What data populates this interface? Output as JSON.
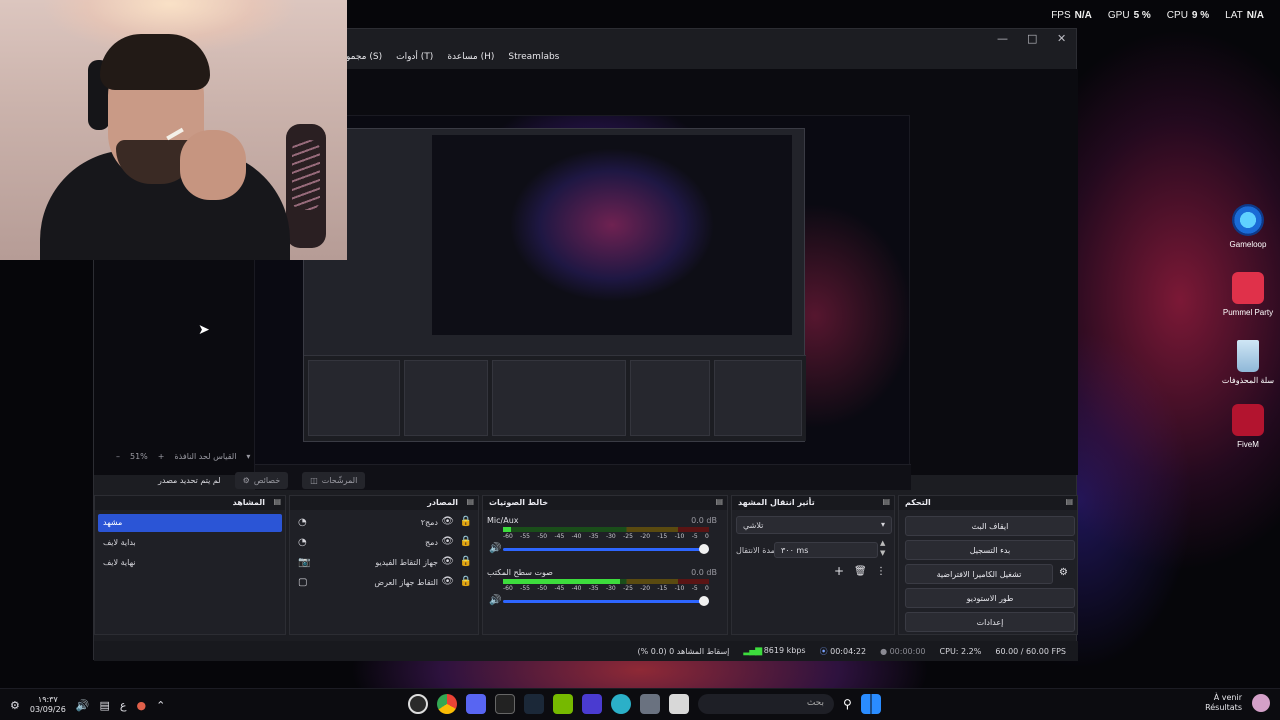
{
  "perf": {
    "fps_label": "FPS",
    "fps_value": "N/A",
    "gpu_label": "GPU",
    "gpu_value": "5 %",
    "cpu_label": "CPU",
    "cpu_value": "9 %",
    "lat_label": "LAT",
    "lat_value": "N/A"
  },
  "desktop_icons": [
    "Gameloop",
    "Pummel Party",
    "سلة المحذوفات",
    "FiveM"
  ],
  "menu": [
    "مجمو (S)",
    "أدوات (T)",
    "مساعدة (H)",
    "Streamlabs"
  ],
  "preview": {
    "zoom": "51%",
    "scale_hint": "القياس لحد النافذة"
  },
  "source_bar": {
    "no_source": "لم يتم تحديد مصدر",
    "properties": "خصائص",
    "filters": "المرشّحات"
  },
  "scenes": {
    "title": "المشاهد",
    "items": [
      "مشهد",
      "بداية لايف",
      "نهاية لايف"
    ],
    "selected": 0
  },
  "sources": {
    "title": "المصادر",
    "items": [
      {
        "name": "دمج٢",
        "kind": "browser-icon"
      },
      {
        "name": "دمج",
        "kind": "browser-icon"
      },
      {
        "name": "جهاز التقاط الفيديو",
        "kind": "camera-icon"
      },
      {
        "name": "التقاط جهاز العرض",
        "kind": "monitor-icon"
      }
    ]
  },
  "mixer": {
    "title": "خالط الصوتيات",
    "channels": [
      {
        "name": "Mic/Aux",
        "db": "0.0 dB",
        "level": 0.04
      },
      {
        "name": "صوت سطح المكتب",
        "db": "0.0 dB",
        "level": 0.57
      }
    ],
    "scale": [
      "-60",
      "-55",
      "-50",
      "-45",
      "-40",
      "-35",
      "-30",
      "-25",
      "-20",
      "-15",
      "-10",
      "-5",
      "0"
    ]
  },
  "transitions": {
    "title": "تأثير انتقال المشهد",
    "selected": "تلاشي",
    "duration_label": "مدة الانتقال",
    "duration_value": "٣٠٠ ms"
  },
  "controls": {
    "title": "التحكم",
    "buttons": [
      "ايقاف البث",
      "بدء التسجيل",
      "تشغيل الكاميرا الافتراضية",
      "طور الاستوديو",
      "إعدادات"
    ]
  },
  "status": {
    "dropped": "إسقاط المشاهد 0 (0.0 %)",
    "bitrate": "8619 kbps",
    "stream_time": "00:04:22",
    "rec_time": "00:00:00",
    "cpu": "CPU: 2.2%",
    "fps": "60.00 / 60.00 FPS"
  },
  "taskbar": {
    "time": "١٩:٣٧",
    "date": "03/09/26",
    "lang": "ع",
    "search": "بحث",
    "notif_title": "À venir",
    "notif_sub": "Résultats"
  },
  "colors": {
    "accent": "#2b55d6",
    "meter_green": "#3ddc3d",
    "slider": "#2e66ff"
  }
}
